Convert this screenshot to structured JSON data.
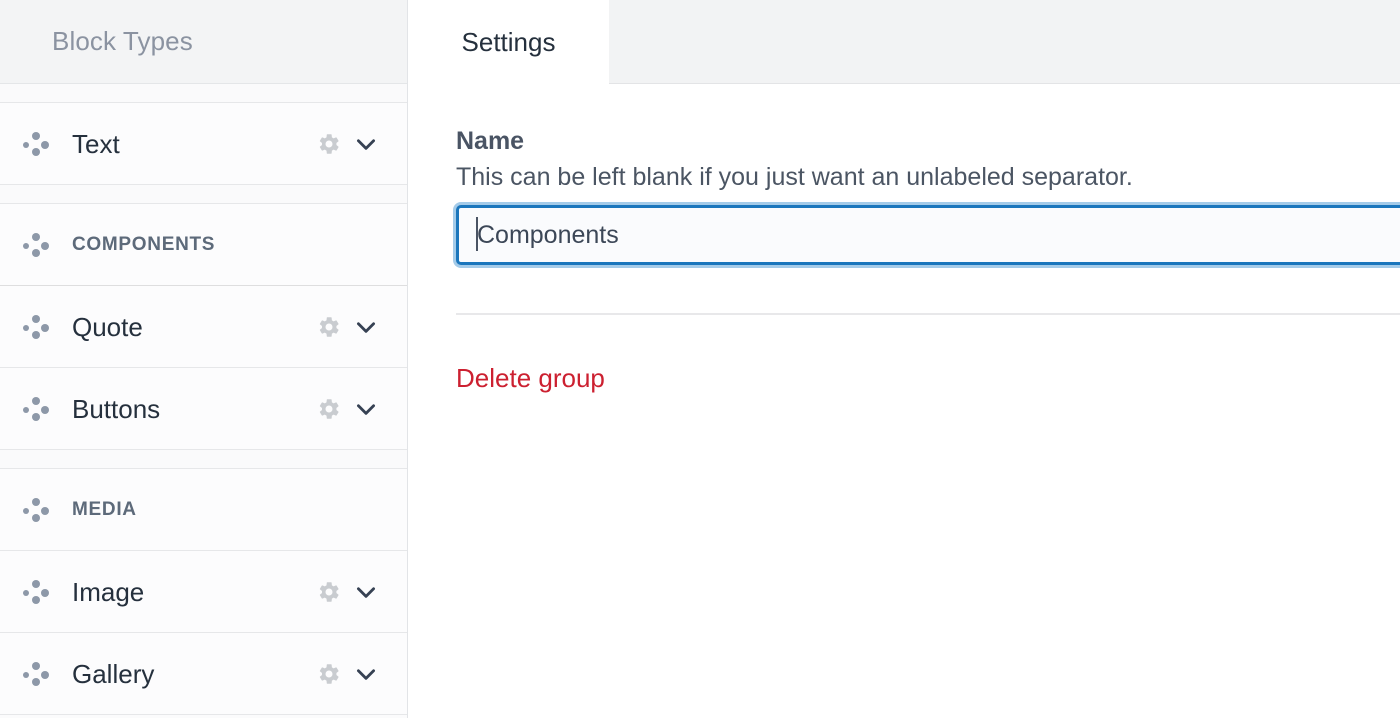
{
  "sidebar": {
    "title": "Block Types",
    "rows": [
      {
        "kind": "spacer"
      },
      {
        "kind": "block",
        "label": "Text",
        "selected": false,
        "has_actions": true,
        "drag_icon": "drag-dots-icon",
        "gear_icon": "gear-icon",
        "chevron_icon": "chevron-down-icon"
      },
      {
        "kind": "spacer"
      },
      {
        "kind": "group",
        "label": "COMPONENTS",
        "selected": true,
        "has_actions": false,
        "drag_icon": "drag-dots-icon"
      },
      {
        "kind": "block",
        "label": "Quote",
        "selected": false,
        "has_actions": true,
        "drag_icon": "drag-dots-icon",
        "gear_icon": "gear-icon",
        "chevron_icon": "chevron-down-icon"
      },
      {
        "kind": "block",
        "label": "Buttons",
        "selected": false,
        "has_actions": true,
        "drag_icon": "drag-dots-icon",
        "gear_icon": "gear-icon",
        "chevron_icon": "chevron-down-icon"
      },
      {
        "kind": "spacer"
      },
      {
        "kind": "group",
        "label": "MEDIA",
        "selected": false,
        "has_actions": false,
        "drag_icon": "drag-dots-icon"
      },
      {
        "kind": "block",
        "label": "Image",
        "selected": false,
        "has_actions": true,
        "drag_icon": "drag-dots-icon",
        "gear_icon": "gear-icon",
        "chevron_icon": "chevron-down-icon"
      },
      {
        "kind": "block",
        "label": "Gallery",
        "selected": false,
        "has_actions": true,
        "drag_icon": "drag-dots-icon",
        "gear_icon": "gear-icon",
        "chevron_icon": "chevron-down-icon"
      }
    ]
  },
  "main": {
    "tabs": [
      {
        "label": "Settings",
        "active": true
      }
    ],
    "name_field": {
      "label": "Name",
      "help": "This can be left blank if you just want an unlabeled separator.",
      "value": "Components",
      "placeholder": ""
    },
    "delete_link": "Delete group"
  },
  "colors": {
    "accent": "#1b76bc",
    "danger": "#cc2030",
    "sidebar_bg": "#fbfbfc",
    "selected_row": "#e9e9ea",
    "header_bg": "#f3f4f5",
    "tabstrip_bg": "#f2f3f4",
    "text_primary": "#25303d",
    "text_muted": "#8b93a1"
  }
}
